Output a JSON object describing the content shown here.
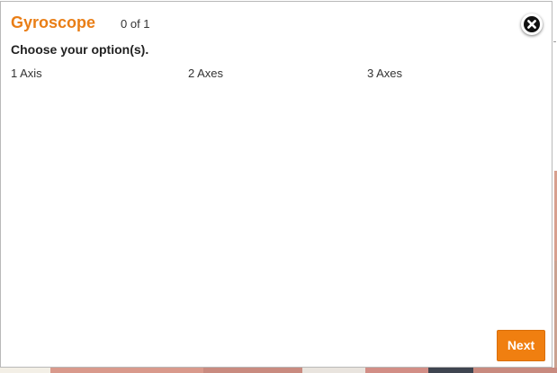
{
  "dialog": {
    "title": "Gyroscope",
    "counter": "0 of 1",
    "prompt": "Choose your option(s).",
    "options": [
      {
        "label": "1 Axis"
      },
      {
        "label": "2 Axes"
      },
      {
        "label": "3 Axes"
      }
    ],
    "next_label": "Next",
    "close_icon": "close-icon"
  },
  "colors": {
    "accent": "#e97e16",
    "button": "#f07f10",
    "border": "#b9b9b9"
  }
}
